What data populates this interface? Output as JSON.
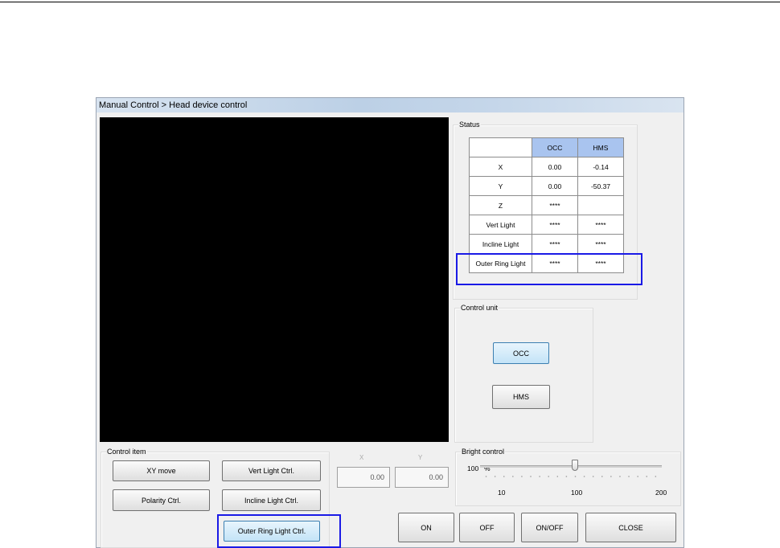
{
  "window": {
    "title": "Manual Control > Head device control"
  },
  "status": {
    "label": "Status",
    "columns": [
      "OCC",
      "HMS"
    ],
    "rows": [
      {
        "label": "X",
        "occ": "0.00",
        "hms": "-0.14"
      },
      {
        "label": "Y",
        "occ": "0.00",
        "hms": "-50.37"
      },
      {
        "label": "Z",
        "occ": "****",
        "hms": ""
      },
      {
        "label": "Vert Light",
        "occ": "****",
        "hms": "****"
      },
      {
        "label": "Incline Light",
        "occ": "****",
        "hms": "****"
      },
      {
        "label": "Outer Ring Light",
        "occ": "****",
        "hms": "****"
      }
    ]
  },
  "control_unit": {
    "label": "Control unit",
    "occ_label": "OCC",
    "hms_label": "HMS",
    "selected": "OCC"
  },
  "control_item": {
    "label": "Control item",
    "xy_move": "XY move",
    "vert_light": "Vert Light Ctrl.",
    "polarity": "Polarity Ctrl.",
    "incline_light": "Incline Light Ctrl.",
    "outer_ring_light": "Outer Ring Light Ctrl."
  },
  "xy": {
    "x_label": "X",
    "y_label": "Y",
    "x_value": "0.00",
    "y_value": "0.00"
  },
  "bright": {
    "label": "Bright control",
    "value": "100",
    "unit": "%",
    "min_label": "10",
    "mid_label": "100",
    "max_label": "200",
    "level_fraction": 0.47
  },
  "actions": {
    "on": "ON",
    "off": "OFF",
    "on_off": "ON/OFF",
    "close": "CLOSE"
  },
  "highlight_color": "#1a1ae6",
  "header_color": "#a9c4ef"
}
